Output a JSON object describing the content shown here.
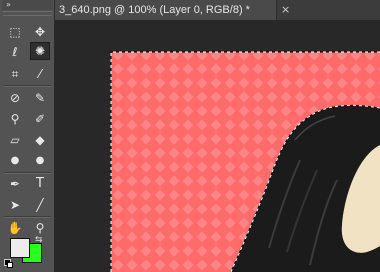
{
  "document_tab": {
    "title": "3_640.png @ 100% (Layer 0, RGB/8) *",
    "close_icon": "×"
  },
  "toolbar": {
    "collapse_icon": "»",
    "tools": [
      {
        "name": "rectangular-marquee-icon",
        "glyph": "⬚"
      },
      {
        "name": "move-tool-icon",
        "glyph": "✥"
      },
      {
        "name": "lasso-tool-icon",
        "glyph": "ℓ"
      },
      {
        "name": "magic-wand-icon",
        "glyph": "✺"
      },
      {
        "name": "crop-tool-icon",
        "glyph": "⌗"
      },
      {
        "name": "eyedropper-icon",
        "glyph": "⁄"
      },
      {
        "name": "healing-brush-icon",
        "glyph": "⊘"
      },
      {
        "name": "brush-tool-icon",
        "glyph": "✎"
      },
      {
        "name": "clone-stamp-icon",
        "glyph": "⚲"
      },
      {
        "name": "history-brush-icon",
        "glyph": "✐"
      },
      {
        "name": "eraser-tool-icon",
        "glyph": "▱"
      },
      {
        "name": "paint-bucket-icon",
        "glyph": "◆"
      },
      {
        "name": "blur-tool-icon",
        "glyph": "●"
      },
      {
        "name": "dodge-tool-icon",
        "glyph": "●"
      },
      {
        "name": "pen-tool-icon",
        "glyph": "✒"
      },
      {
        "name": "type-tool-icon",
        "glyph": "T"
      },
      {
        "name": "path-selection-icon",
        "glyph": "➤"
      },
      {
        "name": "line-tool-icon",
        "glyph": "╱"
      },
      {
        "name": "hand-tool-icon",
        "glyph": "✋"
      },
      {
        "name": "zoom-tool-icon",
        "glyph": "⚲"
      }
    ],
    "swap_icon": "⇆",
    "foreground_color": "#ececec",
    "background_color": "#2bff1f"
  },
  "canvas": {
    "pattern_base_color": "#ff6b6b",
    "pattern_diamond_color": "#ff8585",
    "figure_color": "#1b1b1b",
    "skin_color": "#f1e2c4"
  }
}
